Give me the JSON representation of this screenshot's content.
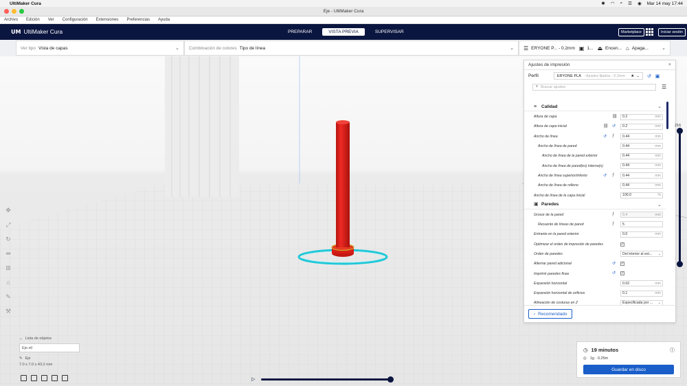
{
  "macos": {
    "app": "UltiMaker Cura",
    "clock": "Mar 14 may 17:44"
  },
  "window": {
    "title": "Eje - UltiMaker Cura"
  },
  "menu": [
    "Archivo",
    "Edición",
    "Ver",
    "Configuración",
    "Extensiones",
    "Preferencias",
    "Ayuda"
  ],
  "header": {
    "logo": "UltiMaker Cura",
    "stages": [
      {
        "label": "PREPARAR",
        "active": false
      },
      {
        "label": "VISTA PREVIA",
        "active": true
      },
      {
        "label": "SUPERVISAR",
        "active": false
      }
    ],
    "marketplace": "Marketplace",
    "signin": "Iniciar sesión"
  },
  "toolbar": {
    "view_type_label": "Ver tipo",
    "view_type_value": "Vista de capas",
    "color_scheme_label": "Combinación de colores",
    "color_scheme_value": "Tipo de línea",
    "printer_profile": "ERYONE P... - 0.2mm",
    "support": "1...",
    "adhesion": "Encen...",
    "extra": "Apaga..."
  },
  "panel": {
    "title": "Ajustes de impresión",
    "profile_label": "Perfil",
    "profile_value": "ERYONE PLA",
    "profile_sub": "- Ajustes fijados - 0.2mm",
    "search_placeholder": "Buscar ajustes",
    "categories": [
      {
        "name": "Calidad",
        "rows": [
          {
            "name": "Altura de capa",
            "indent": 0,
            "value": "0.2",
            "unit": "mm",
            "icons": [
              "link"
            ]
          },
          {
            "name": "Altura de capa inicial",
            "indent": 0,
            "value": "0.2",
            "unit": "mm",
            "icons": [
              "link",
              "reset"
            ]
          },
          {
            "name": "Ancho de línea",
            "indent": 0,
            "value": "0.44",
            "unit": "mm",
            "icons": [
              "reset",
              "fx"
            ]
          },
          {
            "name": "Ancho de línea de pared",
            "indent": 1,
            "value": "0.44",
            "unit": "mm",
            "icons": []
          },
          {
            "name": "Ancho de línea de la pared exterior",
            "indent": 2,
            "value": "0.44",
            "unit": "mm",
            "icons": []
          },
          {
            "name": "Ancho de línea de pared(es) interna(s)",
            "indent": 2,
            "value": "0.44",
            "unit": "mm",
            "icons": []
          },
          {
            "name": "Ancho de línea superior/inferior",
            "indent": 1,
            "value": "0.44",
            "unit": "mm",
            "icons": [
              "reset",
              "fx"
            ]
          },
          {
            "name": "Ancho de línea de relleno",
            "indent": 1,
            "value": "0.44",
            "unit": "mm",
            "icons": []
          },
          {
            "name": "Ancho de línea de la capa inicial",
            "indent": 0,
            "value": "100.0",
            "unit": "%",
            "icons": []
          }
        ]
      },
      {
        "name": "Paredes",
        "rows": [
          {
            "name": "Grosor de la pared",
            "indent": 0,
            "value": "0.4",
            "unit": "mm",
            "icons": [
              "fx"
            ],
            "disabled": true
          },
          {
            "name": "Recuento de líneas de pared",
            "indent": 1,
            "value": "5",
            "unit": "",
            "icons": [
              "fx"
            ]
          },
          {
            "name": "Entrante en la pared exterior",
            "indent": 0,
            "value": "0.0",
            "unit": "mm",
            "icons": []
          },
          {
            "name": "Optimizar el orden de impresión de paredes",
            "indent": 0,
            "check": true,
            "icons": []
          },
          {
            "name": "Orden de paredes",
            "indent": 0,
            "select": "Del interior al ext...",
            "icons": []
          },
          {
            "name": "Alternar pared adicional",
            "indent": 0,
            "check": true,
            "icons": [
              "reset"
            ]
          },
          {
            "name": "Imprimir paredes finas",
            "indent": 0,
            "check": true,
            "icons": [
              "reset"
            ]
          },
          {
            "name": "Expansión horizontal",
            "indent": 0,
            "value": "0.02",
            "unit": "mm",
            "icons": []
          },
          {
            "name": "Expansión horizontal de orificios",
            "indent": 0,
            "value": "0.1",
            "unit": "mm",
            "icons": []
          },
          {
            "name": "Alineación de costuras en Z",
            "indent": 0,
            "select": "Especificada por ...",
            "icons": []
          }
        ]
      }
    ],
    "recommended": "Recomendado"
  },
  "layer": {
    "current": "216",
    "fraction_top": 1.0,
    "fraction_bottom": 0.0
  },
  "objects": {
    "header": "Lista de objetos",
    "file": "Eje.stl",
    "name": "Eje",
    "dims": "7.0 x 7.0 x 43.2 mm"
  },
  "playback": {
    "progress": 1.0
  },
  "summary": {
    "time": "19 minutos",
    "material": "1g · 0.25m",
    "save": "Guardar en disco"
  },
  "colors": {
    "header_bg": "#0b1640",
    "accent": "#1a5ec9",
    "model_red": "#e3201b",
    "skirt_cyan": "#1ec8d8"
  }
}
